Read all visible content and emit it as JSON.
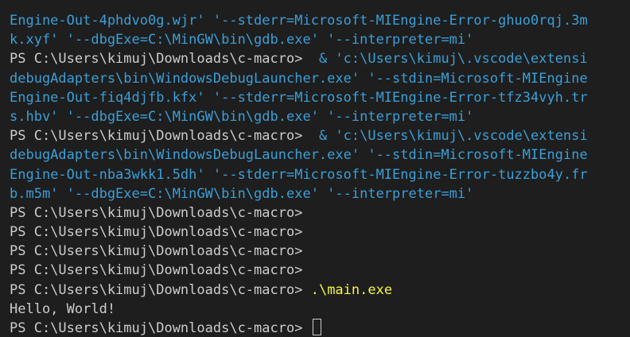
{
  "terminal": {
    "prompt": "PS C:\\Users\\kimuj\\Downloads\\c-macro>",
    "run1": {
      "cont1": "Engine-Out-4phdvo0g.wjr' '--stderr=Microsoft-MIEngine-Error-ghuo0rqj.3m",
      "cont2": "k.xyf' '--dbgExe=C:\\MinGW\\bin\\gdb.exe' '--interpreter=mi'"
    },
    "run2": {
      "cmd": "& 'c:\\Users\\kimuj\\.vscode\\extensi",
      "cont1": "debugAdapters\\bin\\WindowsDebugLauncher.exe' '--stdin=Microsoft-MIEngine",
      "cont2": "Engine-Out-fiq4djfb.kfx' '--stderr=Microsoft-MIEngine-Error-tfz34vyh.tr",
      "cont3": "s.hbv' '--dbgExe=C:\\MinGW\\bin\\gdb.exe' '--interpreter=mi'"
    },
    "run3": {
      "cmd": "& 'c:\\Users\\kimuj\\.vscode\\extensi",
      "cont1": "debugAdapters\\bin\\WindowsDebugLauncher.exe' '--stdin=Microsoft-MIEngine",
      "cont2": "Engine-Out-nba3wkk1.5dh' '--stderr=Microsoft-MIEngine-Error-tuzzbo4y.fr",
      "cont3": "b.m5m' '--dbgExe=C:\\MinGW\\bin\\gdb.exe' '--interpreter=mi'"
    },
    "exec_command": ".\\main.exe",
    "output": "Hello, World!"
  },
  "colors": {
    "background": "#1e1e1e",
    "text": "#cccccc",
    "command_args": "#3b9fd8",
    "command": "#f5f543"
  }
}
